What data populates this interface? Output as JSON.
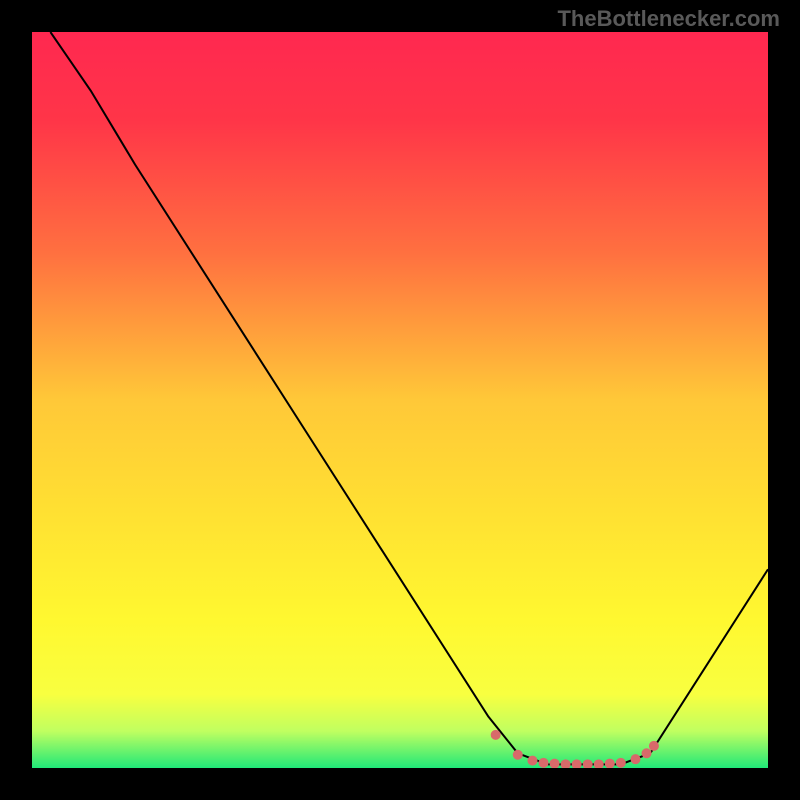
{
  "watermark": "TheBottlenecker.com",
  "chart_data": {
    "type": "line",
    "title": "",
    "xlabel": "",
    "ylabel": "",
    "xlim": [
      0,
      100
    ],
    "ylim": [
      0,
      100
    ],
    "background_gradient": {
      "stops": [
        {
          "offset": 0,
          "color": "#ff2850"
        },
        {
          "offset": 12,
          "color": "#ff3548"
        },
        {
          "offset": 30,
          "color": "#ff7040"
        },
        {
          "offset": 50,
          "color": "#ffc838"
        },
        {
          "offset": 65,
          "color": "#ffe032"
        },
        {
          "offset": 80,
          "color": "#fff830"
        },
        {
          "offset": 90,
          "color": "#f8ff40"
        },
        {
          "offset": 95,
          "color": "#c0ff60"
        },
        {
          "offset": 100,
          "color": "#20e878"
        }
      ]
    },
    "series": [
      {
        "name": "curve",
        "color": "#000000",
        "width": 2,
        "points": [
          {
            "x": 2.5,
            "y": 100
          },
          {
            "x": 8,
            "y": 92
          },
          {
            "x": 14,
            "y": 82
          },
          {
            "x": 62,
            "y": 7
          },
          {
            "x": 66,
            "y": 2
          },
          {
            "x": 70,
            "y": 0.5
          },
          {
            "x": 80,
            "y": 0.5
          },
          {
            "x": 84,
            "y": 2
          },
          {
            "x": 100,
            "y": 27
          }
        ]
      }
    ],
    "markers": {
      "name": "bottleneck-range",
      "color": "#d86a6a",
      "radius": 5,
      "points": [
        {
          "x": 63,
          "y": 4.5
        },
        {
          "x": 66,
          "y": 1.8
        },
        {
          "x": 68,
          "y": 1.0
        },
        {
          "x": 69.5,
          "y": 0.7
        },
        {
          "x": 71,
          "y": 0.6
        },
        {
          "x": 72.5,
          "y": 0.5
        },
        {
          "x": 74,
          "y": 0.5
        },
        {
          "x": 75.5,
          "y": 0.5
        },
        {
          "x": 77,
          "y": 0.5
        },
        {
          "x": 78.5,
          "y": 0.6
        },
        {
          "x": 80,
          "y": 0.7
        },
        {
          "x": 82,
          "y": 1.2
        },
        {
          "x": 83.5,
          "y": 2.0
        },
        {
          "x": 84.5,
          "y": 3.0
        }
      ]
    }
  }
}
